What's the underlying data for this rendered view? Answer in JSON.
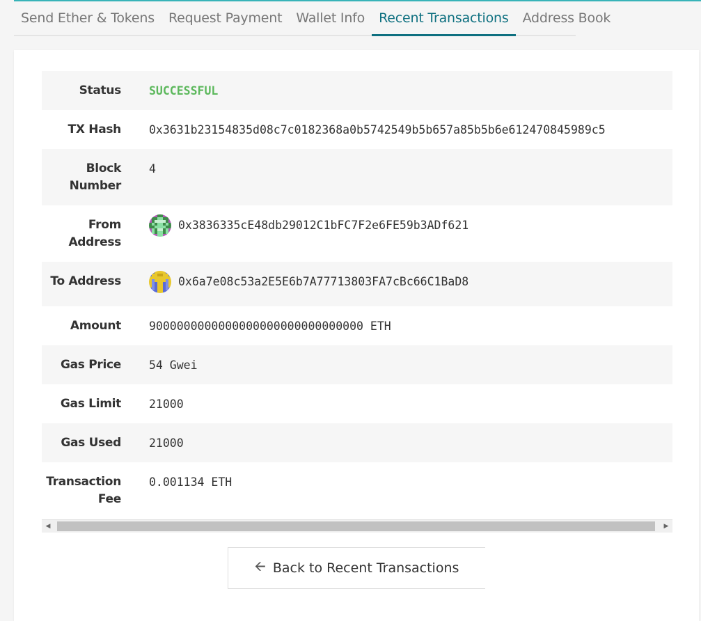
{
  "tabs": [
    {
      "label": "Send Ether & Tokens",
      "active": false
    },
    {
      "label": "Request Payment",
      "active": false
    },
    {
      "label": "Wallet Info",
      "active": false
    },
    {
      "label": "Recent Transactions",
      "active": true
    },
    {
      "label": "Address Book",
      "active": false
    }
  ],
  "details": {
    "status_label": "Status",
    "status_value": "SUCCESSFUL",
    "txhash_label": "TX Hash",
    "txhash_value": "0x3631b23154835d08c7c0182368a0b5742549b5b657a85b5b6e612470845989c5",
    "block_label": "Block Number",
    "block_value": "4",
    "from_label": "From Address",
    "from_value": "0x3836335cE48db29012C1bFC7F2e6FE59b3ADf621",
    "to_label": "To Address",
    "to_value": "0x6a7e08c53a2E5E6b7A77713803FA7cBc66C1BaD8",
    "amount_label": "Amount",
    "amount_value": "9000000000000000000000000000000 ETH",
    "gasprice_label": "Gas Price",
    "gasprice_value": "54 Gwei",
    "gaslimit_label": "Gas Limit",
    "gaslimit_value": "21000",
    "gasused_label": "Gas Used",
    "gasused_value": "21000",
    "fee_label": "Transaction Fee",
    "fee_value": "0.001134 ETH"
  },
  "colors": {
    "accent": "#0e7080",
    "success": "#5cb85c"
  },
  "back_button": {
    "icon": "arrow-left-icon",
    "label": "Back to Recent Transactions"
  }
}
